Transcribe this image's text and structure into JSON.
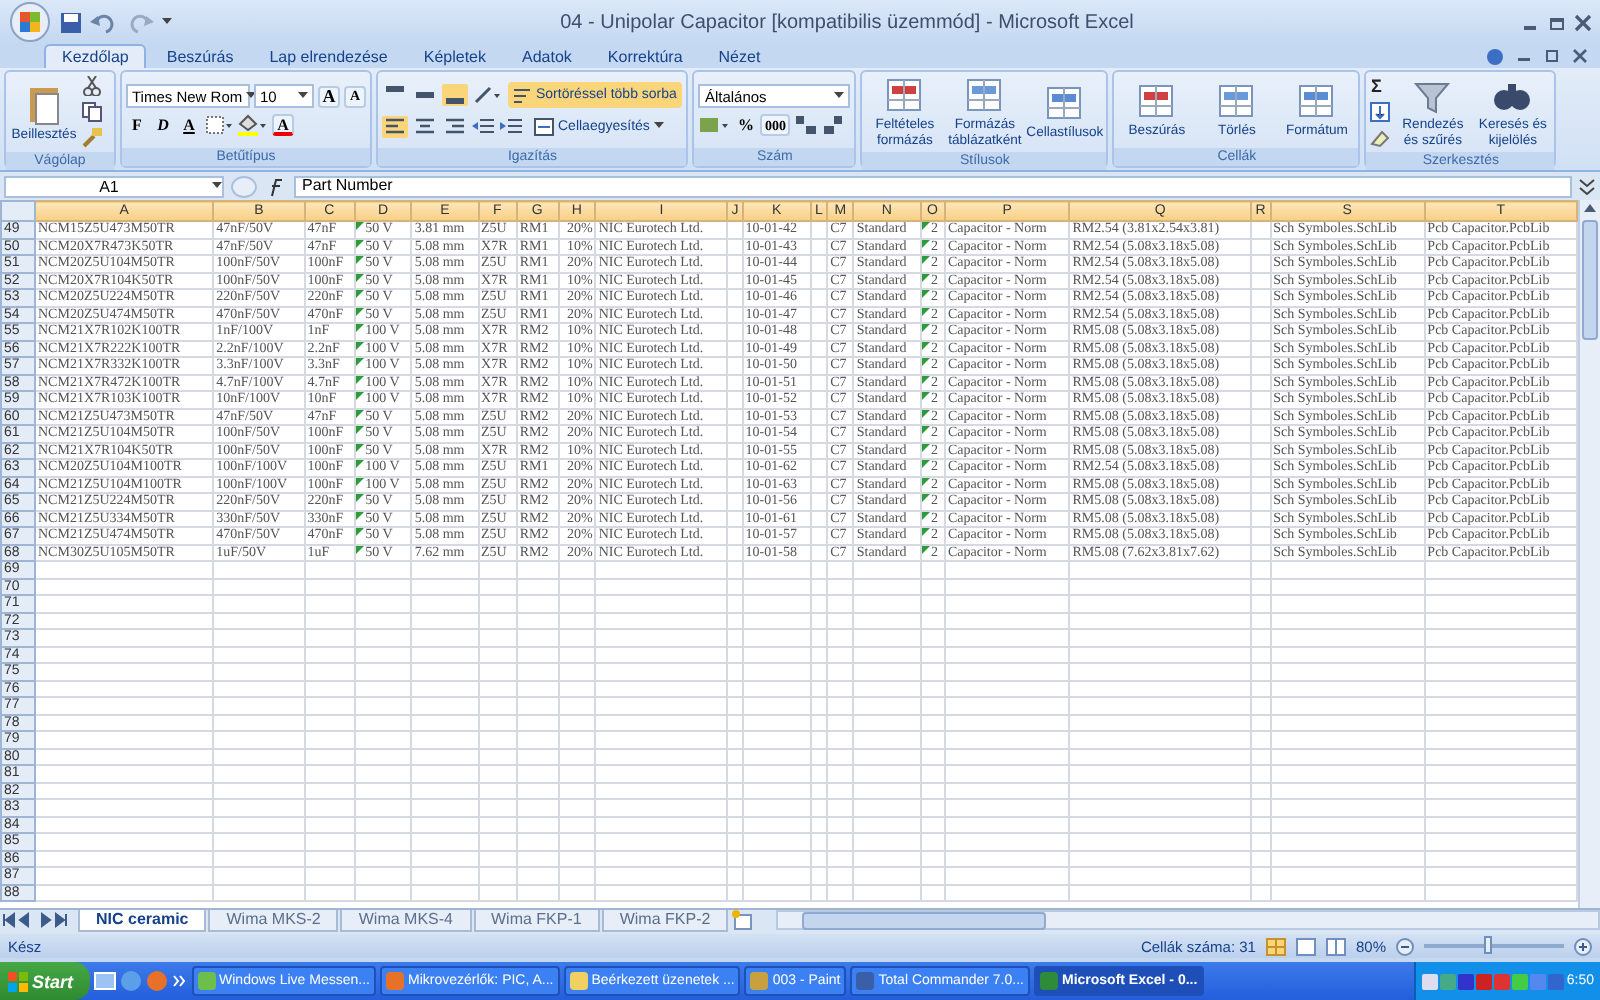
{
  "window": {
    "title": "04 - Unipolar Capacitor  [kompatibilis üzemmód] - Microsoft Excel"
  },
  "ribbon_tabs": [
    {
      "label": "Kezdőlap",
      "selected": true
    },
    {
      "label": "Beszúrás",
      "selected": false
    },
    {
      "label": "Lap elrendezése",
      "selected": false
    },
    {
      "label": "Képletek",
      "selected": false
    },
    {
      "label": "Adatok",
      "selected": false
    },
    {
      "label": "Korrektúra",
      "selected": false
    },
    {
      "label": "Nézet",
      "selected": false
    }
  ],
  "ribbon_groups": [
    {
      "kind": "clipboard",
      "label": "Vágólap",
      "paste": "Beillesztés"
    },
    {
      "kind": "font",
      "label": "Betűtípus",
      "font_name": "Times New Rom",
      "font_size": "10",
      "grow_shrink": [
        "A",
        "A"
      ],
      "style_buttons": [
        "F",
        "D",
        "A"
      ],
      "font_color": "A"
    },
    {
      "kind": "alignment",
      "label": "Igazítás",
      "vertical": [
        {
          "selected": false
        },
        {
          "selected": false
        },
        {
          "selected": true
        }
      ],
      "horizontal": [
        {
          "selected": true
        },
        {
          "selected": false
        },
        {
          "selected": false
        }
      ],
      "wrap": {
        "label": "Sortöréssel több sorba",
        "selected": true
      },
      "merge": "Cellaegyesítés"
    },
    {
      "kind": "number",
      "label": "Szám",
      "format": "Általános",
      "percent": "%",
      "thousands": "000"
    },
    {
      "kind": "large",
      "label": "Stílusok",
      "buttons": [
        "Feltételes formázás",
        "Formázás táblázatként",
        "Cellastílusok"
      ]
    },
    {
      "kind": "large",
      "label": "Cellák",
      "buttons": [
        "Beszúrás",
        "Törlés",
        "Formátum"
      ]
    },
    {
      "kind": "editing",
      "label": "Szerkesztés",
      "sum": "Σ",
      "buttons": [
        "Rendezés és szűrés",
        "Keresés és kijelölés"
      ]
    }
  ],
  "formula_bar": {
    "name_box": "A1",
    "formula": "Part Number"
  },
  "sheet": {
    "columns": [
      "A",
      "B",
      "C",
      "D",
      "E",
      "F",
      "G",
      "H",
      "I",
      "J",
      "K",
      "L",
      "M",
      "N",
      "O",
      "P",
      "Q",
      "R",
      "S",
      "T"
    ],
    "rows": [
      {
        "number": "49",
        "flagged": true,
        "cells": [
          "NCM15Z5U473M50TR",
          "47nF/50V",
          "47nF",
          "50 V",
          "3.81 mm",
          "Z5U",
          "RM1",
          "20%",
          "NIC Eurotech Ltd.",
          null,
          "10-01-42",
          null,
          "C7",
          "Standard",
          "2",
          "Capacitor - Norm",
          "RM2.54 (3.81x2.54x3.81)",
          null,
          "Sch Symboles.SchLib",
          "Pcb Capacitor.PcbLib"
        ]
      },
      {
        "number": "50",
        "flagged": true,
        "cells": [
          "NCM20X7R473K50TR",
          "47nF/50V",
          "47nF",
          "50 V",
          "5.08 mm",
          "X7R",
          "RM1",
          "10%",
          "NIC Eurotech Ltd.",
          null,
          "10-01-43",
          null,
          "C7",
          "Standard",
          "2",
          "Capacitor - Norm",
          "RM2.54 (5.08x3.18x5.08)",
          null,
          "Sch Symboles.SchLib",
          "Pcb Capacitor.PcbLib"
        ]
      },
      {
        "number": "51",
        "flagged": true,
        "cells": [
          "NCM20Z5U104M50TR",
          "100nF/50V",
          "100nF",
          "50 V",
          "5.08 mm",
          "Z5U",
          "RM1",
          "20%",
          "NIC Eurotech Ltd.",
          null,
          "10-01-44",
          null,
          "C7",
          "Standard",
          "2",
          "Capacitor - Norm",
          "RM2.54 (5.08x3.18x5.08)",
          null,
          "Sch Symboles.SchLib",
          "Pcb Capacitor.PcbLib"
        ]
      },
      {
        "number": "52",
        "flagged": true,
        "cells": [
          "NCM20X7R104K50TR",
          "100nF/50V",
          "100nF",
          "50 V",
          "5.08 mm",
          "X7R",
          "RM1",
          "10%",
          "NIC Eurotech Ltd.",
          null,
          "10-01-45",
          null,
          "C7",
          "Standard",
          "2",
          "Capacitor - Norm",
          "RM2.54 (5.08x3.18x5.08)",
          null,
          "Sch Symboles.SchLib",
          "Pcb Capacitor.PcbLib"
        ]
      },
      {
        "number": "53",
        "flagged": true,
        "cells": [
          "NCM20Z5U224M50TR",
          "220nF/50V",
          "220nF",
          "50 V",
          "5.08 mm",
          "Z5U",
          "RM1",
          "20%",
          "NIC Eurotech Ltd.",
          null,
          "10-01-46",
          null,
          "C7",
          "Standard",
          "2",
          "Capacitor - Norm",
          "RM2.54 (5.08x3.18x5.08)",
          null,
          "Sch Symboles.SchLib",
          "Pcb Capacitor.PcbLib"
        ]
      },
      {
        "number": "54",
        "flagged": true,
        "cells": [
          "NCM20Z5U474M50TR",
          "470nF/50V",
          "470nF",
          "50 V",
          "5.08 mm",
          "Z5U",
          "RM1",
          "20%",
          "NIC Eurotech Ltd.",
          null,
          "10-01-47",
          null,
          "C7",
          "Standard",
          "2",
          "Capacitor - Norm",
          "RM2.54 (5.08x3.18x5.08)",
          null,
          "Sch Symboles.SchLib",
          "Pcb Capacitor.PcbLib"
        ]
      },
      {
        "number": "55",
        "flagged": true,
        "cells": [
          "NCM21X7R102K100TR",
          "1nF/100V",
          "1nF",
          "100 V",
          "5.08 mm",
          "X7R",
          "RM2",
          "10%",
          "NIC Eurotech Ltd.",
          null,
          "10-01-48",
          null,
          "C7",
          "Standard",
          "2",
          "Capacitor - Norm",
          "RM5.08 (5.08x3.18x5.08)",
          null,
          "Sch Symboles.SchLib",
          "Pcb Capacitor.PcbLib"
        ]
      },
      {
        "number": "56",
        "flagged": true,
        "cells": [
          "NCM21X7R222K100TR",
          "2.2nF/100V",
          "2.2nF",
          "100 V",
          "5.08 mm",
          "X7R",
          "RM2",
          "10%",
          "NIC Eurotech Ltd.",
          null,
          "10-01-49",
          null,
          "C7",
          "Standard",
          "2",
          "Capacitor - Norm",
          "RM5.08 (5.08x3.18x5.08)",
          null,
          "Sch Symboles.SchLib",
          "Pcb Capacitor.PcbLib"
        ]
      },
      {
        "number": "57",
        "flagged": true,
        "cells": [
          "NCM21X7R332K100TR",
          "3.3nF/100V",
          "3.3nF",
          "100 V",
          "5.08 mm",
          "X7R",
          "RM2",
          "10%",
          "NIC Eurotech Ltd.",
          null,
          "10-01-50",
          null,
          "C7",
          "Standard",
          "2",
          "Capacitor - Norm",
          "RM5.08 (5.08x3.18x5.08)",
          null,
          "Sch Symboles.SchLib",
          "Pcb Capacitor.PcbLib"
        ]
      },
      {
        "number": "58",
        "flagged": true,
        "cells": [
          "NCM21X7R472K100TR",
          "4.7nF/100V",
          "4.7nF",
          "100 V",
          "5.08 mm",
          "X7R",
          "RM2",
          "10%",
          "NIC Eurotech Ltd.",
          null,
          "10-01-51",
          null,
          "C7",
          "Standard",
          "2",
          "Capacitor - Norm",
          "RM5.08 (5.08x3.18x5.08)",
          null,
          "Sch Symboles.SchLib",
          "Pcb Capacitor.PcbLib"
        ]
      },
      {
        "number": "59",
        "flagged": true,
        "cells": [
          "NCM21X7R103K100TR",
          "10nF/100V",
          "10nF",
          "100 V",
          "5.08 mm",
          "X7R",
          "RM2",
          "10%",
          "NIC Eurotech Ltd.",
          null,
          "10-01-52",
          null,
          "C7",
          "Standard",
          "2",
          "Capacitor - Norm",
          "RM5.08 (5.08x3.18x5.08)",
          null,
          "Sch Symboles.SchLib",
          "Pcb Capacitor.PcbLib"
        ]
      },
      {
        "number": "60",
        "flagged": true,
        "cells": [
          "NCM21Z5U473M50TR",
          "47nF/50V",
          "47nF",
          "50 V",
          "5.08 mm",
          "Z5U",
          "RM2",
          "20%",
          "NIC Eurotech Ltd.",
          null,
          "10-01-53",
          null,
          "C7",
          "Standard",
          "2",
          "Capacitor - Norm",
          "RM5.08 (5.08x3.18x5.08)",
          null,
          "Sch Symboles.SchLib",
          "Pcb Capacitor.PcbLib"
        ]
      },
      {
        "number": "61",
        "flagged": true,
        "cells": [
          "NCM21Z5U104M50TR",
          "100nF/50V",
          "100nF",
          "50 V",
          "5.08 mm",
          "Z5U",
          "RM2",
          "20%",
          "NIC Eurotech Ltd.",
          null,
          "10-01-54",
          null,
          "C7",
          "Standard",
          "2",
          "Capacitor - Norm",
          "RM5.08 (5.08x3.18x5.08)",
          null,
          "Sch Symboles.SchLib",
          "Pcb Capacitor.PcbLib"
        ]
      },
      {
        "number": "62",
        "flagged": true,
        "cells": [
          "NCM21X7R104K50TR",
          "100nF/50V",
          "100nF",
          "50 V",
          "5.08 mm",
          "X7R",
          "RM2",
          "10%",
          "NIC Eurotech Ltd.",
          null,
          "10-01-55",
          null,
          "C7",
          "Standard",
          "2",
          "Capacitor - Norm",
          "RM5.08 (5.08x3.18x5.08)",
          null,
          "Sch Symboles.SchLib",
          "Pcb Capacitor.PcbLib"
        ]
      },
      {
        "number": "63",
        "flagged": true,
        "cells": [
          "NCM20Z5U104M100TR",
          "100nF/100V",
          "100nF",
          "100 V",
          "5.08 mm",
          "Z5U",
          "RM1",
          "20%",
          "NIC Eurotech Ltd.",
          null,
          "10-01-62",
          null,
          "C7",
          "Standard",
          "2",
          "Capacitor - Norm",
          "RM2.54 (5.08x3.18x5.08)",
          null,
          "Sch Symboles.SchLib",
          "Pcb Capacitor.PcbLib"
        ]
      },
      {
        "number": "64",
        "flagged": true,
        "cells": [
          "NCM21Z5U104M100TR",
          "100nF/100V",
          "100nF",
          "100 V",
          "5.08 mm",
          "Z5U",
          "RM2",
          "20%",
          "NIC Eurotech Ltd.",
          null,
          "10-01-63",
          null,
          "C7",
          "Standard",
          "2",
          "Capacitor - Norm",
          "RM5.08 (5.08x3.18x5.08)",
          null,
          "Sch Symboles.SchLib",
          "Pcb Capacitor.PcbLib"
        ]
      },
      {
        "number": "65",
        "flagged": true,
        "cells": [
          "NCM21Z5U224M50TR",
          "220nF/50V",
          "220nF",
          "50 V",
          "5.08 mm",
          "Z5U",
          "RM2",
          "20%",
          "NIC Eurotech Ltd.",
          null,
          "10-01-56",
          null,
          "C7",
          "Standard",
          "2",
          "Capacitor - Norm",
          "RM5.08 (5.08x3.18x5.08)",
          null,
          "Sch Symboles.SchLib",
          "Pcb Capacitor.PcbLib"
        ]
      },
      {
        "number": "66",
        "flagged": true,
        "cells": [
          "NCM21Z5U334M50TR",
          "330nF/50V",
          "330nF",
          "50 V",
          "5.08 mm",
          "Z5U",
          "RM2",
          "20%",
          "NIC Eurotech Ltd.",
          null,
          "10-01-61",
          null,
          "C7",
          "Standard",
          "2",
          "Capacitor - Norm",
          "RM5.08 (5.08x3.18x5.08)",
          null,
          "Sch Symboles.SchLib",
          "Pcb Capacitor.PcbLib"
        ]
      },
      {
        "number": "67",
        "flagged": true,
        "cells": [
          "NCM21Z5U474M50TR",
          "470nF/50V",
          "470nF",
          "50 V",
          "5.08 mm",
          "Z5U",
          "RM2",
          "20%",
          "NIC Eurotech Ltd.",
          null,
          "10-01-57",
          null,
          "C7",
          "Standard",
          "2",
          "Capacitor - Norm",
          "RM5.08 (5.08x3.18x5.08)",
          null,
          "Sch Symboles.SchLib",
          "Pcb Capacitor.PcbLib"
        ]
      },
      {
        "number": "68",
        "flagged": true,
        "cells": [
          "NCM30Z5U105M50TR",
          "1uF/50V",
          "1uF",
          "50 V",
          "7.62 mm",
          "Z5U",
          "RM2",
          "20%",
          "NIC Eurotech Ltd.",
          null,
          "10-01-58",
          null,
          "C7",
          "Standard",
          "2",
          "Capacitor - Norm",
          "RM5.08 (7.62x3.81x7.62)",
          null,
          "Sch Symboles.SchLib",
          "Pcb Capacitor.PcbLib"
        ]
      }
    ],
    "empty_rows": [
      "69",
      "70",
      "71",
      "72",
      "73",
      "74",
      "75",
      "76",
      "77",
      "78",
      "79",
      "80",
      "81",
      "82",
      "83",
      "84",
      "85",
      "86",
      "87",
      "88"
    ]
  },
  "sheet_tabs": [
    {
      "label": "NIC ceramic",
      "selected": true
    },
    {
      "label": "Wima MKS-2",
      "selected": false
    },
    {
      "label": "Wima MKS-4",
      "selected": false
    },
    {
      "label": "Wima FKP-1",
      "selected": false
    },
    {
      "label": "Wima FKP-2",
      "selected": false
    }
  ],
  "status_bar": {
    "ready": "Kész",
    "cell_count": "Cellák száma: 31",
    "zoom": "80%",
    "zoom_slider": {
      "level": 0.45
    }
  },
  "taskbar": {
    "start": "Start",
    "items": [
      {
        "label": "Windows Live Messen...",
        "selected": false
      },
      {
        "label": "Mikrovezérlők: PIC, A...",
        "selected": false
      },
      {
        "label": "Beérkezett üzenetek ...",
        "selected": false
      },
      {
        "label": "003 - Paint",
        "selected": false
      },
      {
        "label": "Total Commander 7.0...",
        "selected": false
      },
      {
        "label": "Microsoft Excel - 0...",
        "selected": true
      }
    ],
    "clock": "6:50"
  }
}
